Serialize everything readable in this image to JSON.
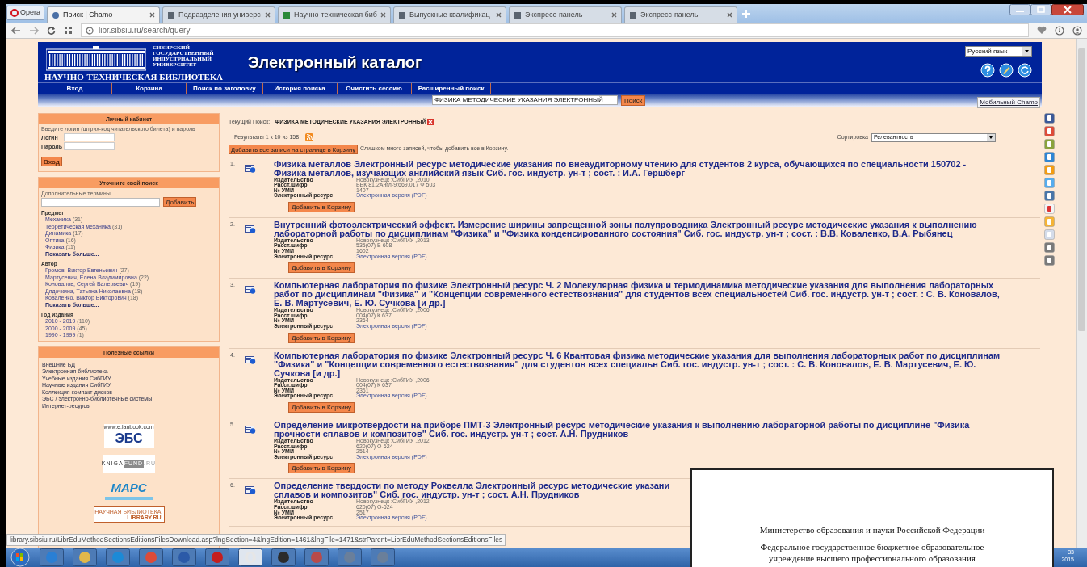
{
  "browser": {
    "opera_button": "Opera",
    "address": "libr.sibsiu.ru/search/query",
    "tabs": [
      {
        "title": "Поиск | Chamo",
        "selected": true
      },
      {
        "title": "Подразделения универс",
        "selected": false
      },
      {
        "title": "Научно-техническая биб",
        "selected": false
      },
      {
        "title": "Выпускные квалификац",
        "selected": false
      },
      {
        "title": "Экспресс-панель",
        "selected": false
      },
      {
        "title": "Экспресс-панель",
        "selected": false
      }
    ]
  },
  "header": {
    "university_lines": [
      "СИБИРСКИЙ",
      "ГОСУДАРСТВЕННЫЙ",
      "ИНДУСТРИАЛЬНЫЙ",
      "УНИВЕРСИТЕТ"
    ],
    "library_name": "НАУЧНО-ТЕХНИЧЕСКАЯ БИБЛИОТЕКА",
    "title": "Электронный каталог",
    "language": "Русский язык"
  },
  "nav": [
    "Вход",
    "Корзина",
    "Поиск по заголовку",
    "История поиска",
    "Очистить сессию",
    "Расширенный поиск"
  ],
  "search": {
    "value": "ФИЗИКА МЕТОДИЧЕСКИЕ УКАЗАНИЯ ЭЛЕКТРОННЫЙ",
    "button": "Поиск",
    "mobile_link": "Мобильный Chamo"
  },
  "login_panel": {
    "title": "Личный кабинет",
    "hint": "Введите логин (штрих-код читательского билета) и пароль",
    "login_label": "Логин",
    "password_label": "Пароль",
    "button": "Вход"
  },
  "refine_panel": {
    "title": "Уточните свой поиск",
    "terms_label": "Дополнительные термины",
    "add_button": "Добавить",
    "facets": [
      {
        "title": "Предмет",
        "more": "Показать больше...",
        "items": [
          {
            "name": "Механика",
            "count": "(31)"
          },
          {
            "name": "Теоретическая механика",
            "count": "(31)"
          },
          {
            "name": "Динамика",
            "count": "(17)"
          },
          {
            "name": "Оптика",
            "count": "(16)"
          },
          {
            "name": "Физика",
            "count": "(11)"
          }
        ]
      },
      {
        "title": "Автор",
        "more": "Показать больше...",
        "items": [
          {
            "name": "Громов, Виктор Евгеньевич",
            "count": "(27)"
          },
          {
            "name": "Мартусевич, Елена Владимировна",
            "count": "(22)"
          },
          {
            "name": "Коновалов, Сергей Валерьевич",
            "count": "(19)"
          },
          {
            "name": "Дядочкина, Татьяна Николаевна",
            "count": "(18)"
          },
          {
            "name": "Коваленко, Виктор Викторович",
            "count": "(18)"
          }
        ]
      },
      {
        "title": "Год издания",
        "items": [
          {
            "name": "2010 - 2019",
            "count": "(110)"
          },
          {
            "name": "2000 - 2009",
            "count": "(45)"
          },
          {
            "name": "1990 - 1999",
            "count": "(1)"
          }
        ]
      }
    ]
  },
  "links_panel": {
    "title": "Полезные ссылки",
    "links": [
      "Внешние БД",
      "Электронная библиотека",
      "Учебные издания СибГИУ",
      "Научные издания СибГИУ",
      "Коллекция компакт-дисков",
      "ЭБС / электронно-библиотечные системы",
      "Интернет-ресурсы"
    ],
    "logos": [
      {
        "kind": "lanbook",
        "lines": [
          "www.e.lanbook.com",
          "ЭБС"
        ]
      },
      {
        "kind": "knigafund",
        "lines": [
          "KNIGA",
          "FUND",
          ".RU"
        ]
      },
      {
        "kind": "mars",
        "lines": [
          "МАРС"
        ]
      },
      {
        "kind": "elibrary",
        "lines": [
          "НАУЧНАЯ БИБЛИОТЕКА",
          "LIBRARY.RU"
        ]
      }
    ]
  },
  "results_header": {
    "current_label": "Текущий Поиск:",
    "current_query": "ФИЗИКА МЕТОДИЧЕСКИЕ УКАЗАНИЯ ЭЛЕКТРОННЫЙ",
    "count": "Результаты 1 к 10 из 158",
    "sort_label": "Сортировка",
    "sort_value": "Релевантность",
    "add_all_button": "Добавить все записи на странице в Корзину",
    "add_all_note": "Слишком много записей, чтобы добавить все в Корзину."
  },
  "results": [
    {
      "number": "1.",
      "title_lines": [
        "Физика металлов Электронный ресурс методические указания по внеаудиторному чтению для студентов 2 курса, обучающихся по специальности 150702 -",
        "Физика металлов, изучающих английский язык Сиб. гос. индустр. ун-т ; сост. : И.А. Гершберг"
      ],
      "fields": [
        {
          "label": "Издательство",
          "value": "Новокузнецк :СибГИУ ,2010",
          "kind": "text"
        },
        {
          "label": "Расст.шифр",
          "value": "ББК 81.2Англ-9:669.017 Ф 503",
          "kind": "text"
        },
        {
          "label": "№ УМИ",
          "value": "1407",
          "kind": "text"
        },
        {
          "label": "Электронный ресурс",
          "value": "Электронная версия (PDF)",
          "kind": "link"
        }
      ],
      "cart_button": "Добавить в Корзину"
    },
    {
      "number": "2.",
      "title_lines": [
        "Внутренний фотоэлектрический эффект. Измерение ширины запрещенной зоны полупроводника Электронный ресурс методические указания к выполнению",
        "лабораторной работы по дисциплинам \"Физика\" и \"Физика конденсированного состояния\" Сиб. гос. индустр. ун-т ; сост. : В.В. Коваленко, В.А. Рыбянец"
      ],
      "fields": [
        {
          "label": "Издательство",
          "value": "Новокузнецк :СибГИУ ,2013",
          "kind": "text"
        },
        {
          "label": "Расст.шифр",
          "value": "535(07) В 608",
          "kind": "text"
        },
        {
          "label": "№ УМИ",
          "value": "1602",
          "kind": "text"
        },
        {
          "label": "Электронный ресурс",
          "value": "Электронная версия (PDF)",
          "kind": "link"
        }
      ],
      "cart_button": "Добавить в Корзину"
    },
    {
      "number": "3.",
      "title_lines": [
        "Компьютерная лаборатория по физике Электронный ресурс Ч. 2 Молекулярная физика и термодинамика методические указания для выполнения лабораторных",
        "работ по дисциплинам \"Физика\" и \"Концепции современного естествознания\" для студентов всех специальностей Сиб. гос. индустр. ун-т ; сост. : С. В. Коновалов,",
        "Е. В. Мартусевич, Е. Ю. Сучкова [и др.]"
      ],
      "fields": [
        {
          "label": "Издательство",
          "value": "Новокузнецк :СибГИУ ,2006",
          "kind": "text"
        },
        {
          "label": "Расст.шифр",
          "value": "004(07) К 637",
          "kind": "text"
        },
        {
          "label": "№ УМИ",
          "value": "2364",
          "kind": "text"
        },
        {
          "label": "Электронный ресурс",
          "value": "Электронная версия (PDF)",
          "kind": "link"
        }
      ],
      "cart_button": "Добавить в Корзину"
    },
    {
      "number": "4.",
      "title_lines": [
        "Компьютерная лаборатория по физике Электронный ресурс Ч. 6 Квантовая физика методические указания для выполнения лабораторных работ по дисциплинам",
        "\"Физика\" и \"Концепции современного естествознания\" для студентов всех специальн Сиб. гос. индустр. ун-т ; сост. : С. В. Коновалов, Е. В. Мартусевич, Е. Ю.",
        "Сучкова [и др.]"
      ],
      "fields": [
        {
          "label": "Издательство",
          "value": "Новокузнецк :СибГИУ ,2006",
          "kind": "text"
        },
        {
          "label": "Расст.шифр",
          "value": "004(07) К 637",
          "kind": "text"
        },
        {
          "label": "№ УМИ",
          "value": "2361",
          "kind": "text"
        },
        {
          "label": "Электронный ресурс",
          "value": "Электронная версия (PDF)",
          "kind": "link"
        }
      ],
      "cart_button": "Добавить в Корзину"
    },
    {
      "number": "5.",
      "title_lines": [
        "Определение микротвердости на приборе ПМТ-3 Электронный ресурс методические указания к выполнению лабораторной работы по дисциплине \"Физика",
        "прочности сплавов и композитов\" Сиб. гос. индустр. ун-т ; сост. А.Н. Прудников"
      ],
      "fields": [
        {
          "label": "Издательство",
          "value": "Новокузнецк :СибГИУ ,2012",
          "kind": "text"
        },
        {
          "label": "Расст.шифр",
          "value": "620(07) О-624",
          "kind": "text"
        },
        {
          "label": "№ УМИ",
          "value": "2514",
          "kind": "text"
        },
        {
          "label": "Электронный ресурс",
          "value": "Электронная версия (PDF)",
          "kind": "link"
        }
      ],
      "cart_button": "Добавить в Корзину"
    },
    {
      "number": "6.",
      "title_lines": [
        "Определение твердости по методу Роквелла Электронный ресурс методические указани",
        "сплавов и композитов\" Сиб. гос. индустр. ун-т ; сост. А.Н. Прудников"
      ],
      "fields": [
        {
          "label": "Издательство",
          "value": "Новокузнецк :СибГИУ ,2012",
          "kind": "text"
        },
        {
          "label": "Расст.шифр",
          "value": "620(07) О-624",
          "kind": "text"
        },
        {
          "label": "№ УМИ",
          "value": "2517",
          "kind": "text"
        },
        {
          "label": "Электронный ресурс",
          "value": "Электронная версия (PDF)",
          "kind": "link"
        }
      ]
    }
  ],
  "status_bar": "library.sibsiu.ru/LibrEduMethodSectionsEditionsFilesDownload.asp?lngSection=4&lngEdition=1461&lngFile=1471&strParent=LibrEduMethodSectionsEditionsFiles",
  "clock": [
    "33",
    "2015"
  ],
  "document_preview": {
    "lines": [
      "Министерство образования и науки Российской Федерации",
      "Федеральное государственное бюджетное образовательное",
      "учреждение высшего профессионального образования"
    ]
  }
}
